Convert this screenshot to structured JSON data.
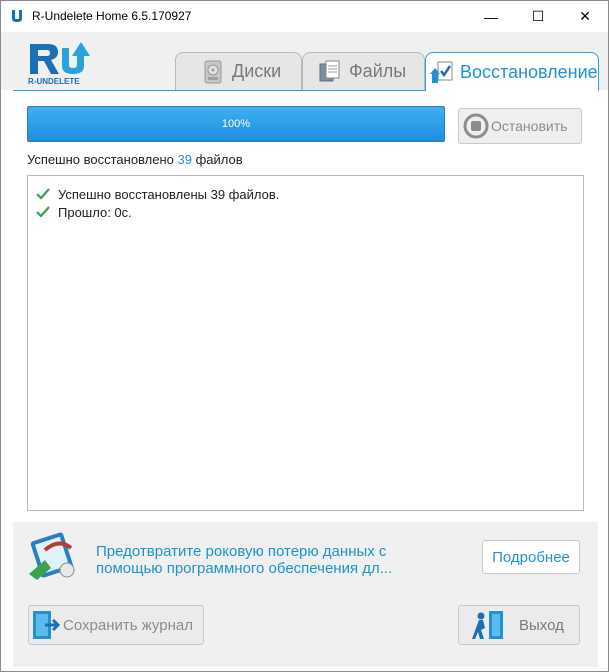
{
  "window": {
    "title": "R-Undelete Home 6.5.170927",
    "controls": {
      "minimize": "—",
      "maximize": "☐",
      "close": "✕"
    }
  },
  "logo": {
    "text": "R-UNDELETE"
  },
  "tabs": [
    {
      "label": "Диски",
      "icon": "disk-icon",
      "active": false
    },
    {
      "label": "Файлы",
      "icon": "files-icon",
      "active": false
    },
    {
      "label": "Восстановление",
      "icon": "restore-icon",
      "active": true
    }
  ],
  "progress": {
    "percent": 100,
    "label": "100%"
  },
  "stop_button": {
    "label": "Остановить"
  },
  "summary": {
    "prefix": "Успешно восстановлено ",
    "count": "39",
    "suffix": " файлов"
  },
  "log": [
    {
      "text": "Успешно восстановлены 39 файлов.",
      "icon": "check-icon"
    },
    {
      "text": "Прошло: 0с.",
      "icon": "check-icon"
    }
  ],
  "banner": {
    "text": "Предотвратите роковую потерю данных с помощью программного обеспечения дл...",
    "more_button": "Подробнее"
  },
  "footer": {
    "save_log": "Сохранить журнал",
    "exit": "Выход"
  },
  "colors": {
    "accent": "#1e93d3",
    "progress": "#2a9fe8",
    "check": "#3aa24a"
  }
}
